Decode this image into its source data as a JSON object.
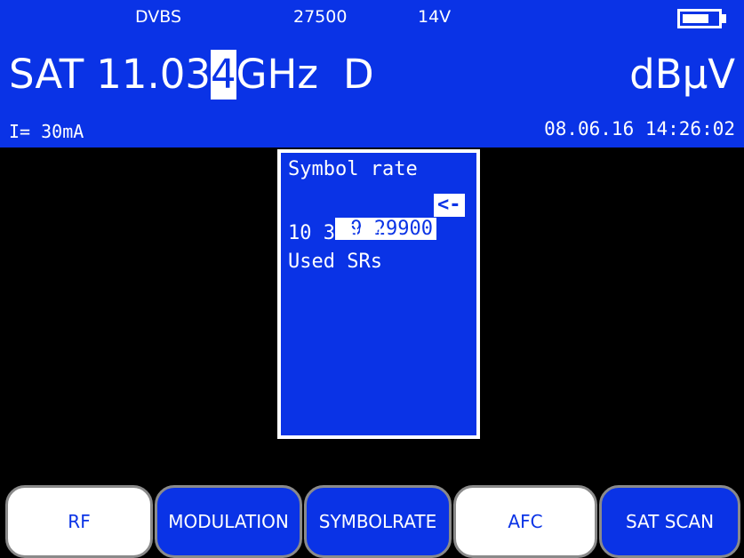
{
  "header": {
    "standard": "DVBS",
    "symbol_rate": "27500",
    "lnb_voltage": "14V",
    "battery_level_fraction": 0.75,
    "band": "SAT",
    "frequency_prefix": "11.03",
    "frequency_cursor_digit": "4",
    "frequency_unit": "GHz",
    "polarity_flag": "D",
    "level_unit": "dBµV",
    "current": "I= 30mA",
    "datetime": "08.06.16 14:26:02"
  },
  "popup": {
    "title": "Symbol rate",
    "selected_item": " 9 29900",
    "selected_marker": "<-",
    "item2": "10 30000",
    "item3": "Used SRs"
  },
  "softkeys": {
    "rf": "RF",
    "modulation": "MODULATION",
    "symbolrate": "SYMBOLRATE",
    "afc": "AFC",
    "sat_scan": "SAT SCAN"
  },
  "colors": {
    "accent_blue": "#0a33e6",
    "background": "#000000",
    "text": "#ffffff"
  }
}
